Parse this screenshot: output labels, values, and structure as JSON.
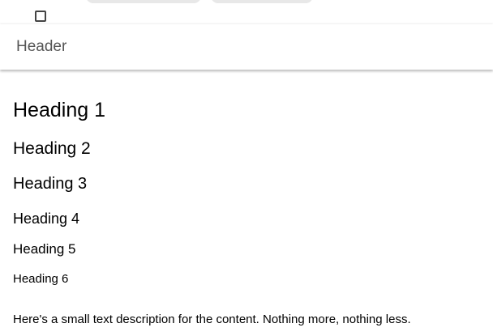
{
  "header": {
    "title": "Header"
  },
  "content": {
    "headings": [
      "Heading 1",
      "Heading 2",
      "Heading 3",
      "Heading 4",
      "Heading 5",
      "Heading 6"
    ],
    "description": "Here's a small text description for the content. Nothing more, nothing less."
  },
  "colors": {
    "header_text": "#555555",
    "body_text": "#000000",
    "background": "#ffffff"
  }
}
